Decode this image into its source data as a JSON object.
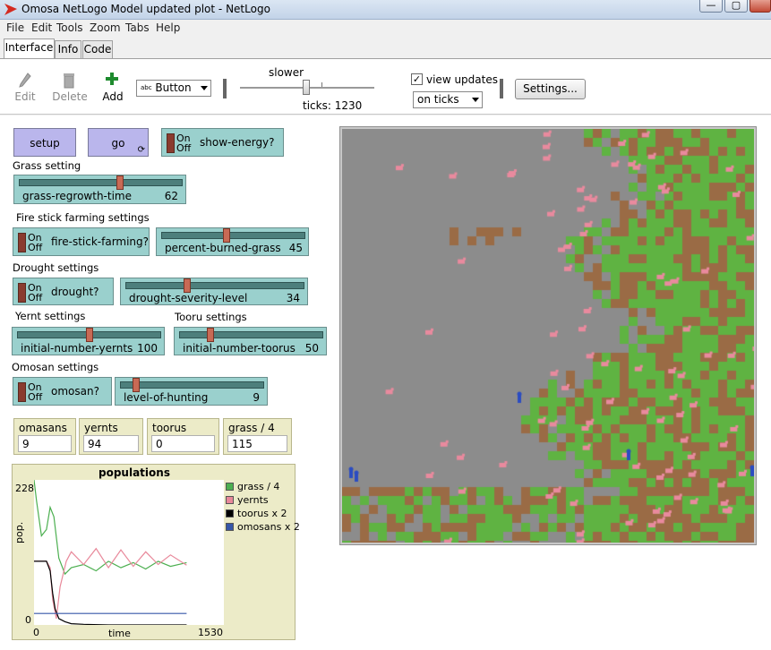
{
  "window": {
    "title": "Omosa NetLogo Model updated plot - NetLogo",
    "minimize": "—",
    "maximize": "▢"
  },
  "menu": [
    "File",
    "Edit",
    "Tools",
    "Zoom",
    "Tabs",
    "Help"
  ],
  "tabs": [
    "Interface",
    "Info",
    "Code"
  ],
  "toolbar": {
    "edit": "Edit",
    "delete": "Delete",
    "add": "Add",
    "widget_select": "Button",
    "widget_select_prefix": "abc",
    "speed_label": "slower",
    "ticks": "ticks: 1230",
    "view_updates": "view updates",
    "update_mode": "on ticks",
    "settings": "Settings..."
  },
  "buttons": {
    "setup": "setup",
    "go": "go"
  },
  "switch_labels": {
    "on": "On",
    "off": "Off"
  },
  "switches": {
    "show_energy": "show-energy?",
    "fire_stick": "fire-stick-farming?",
    "drought": "drought?",
    "omosan": "omosan?"
  },
  "notes": {
    "grass": "Grass setting",
    "fire": "Fire stick farming settings",
    "drought": "Drought settings",
    "yernt": "Yernt settings",
    "tooru": "Tooru settings",
    "omosan": "Omosan settings"
  },
  "sliders": {
    "grass_regrowth": {
      "name": "grass-regrowth-time",
      "value": "62",
      "fraction": 0.62
    },
    "percent_burned": {
      "name": "percent-burned-grass",
      "value": "45",
      "fraction": 0.45
    },
    "drought_severity": {
      "name": "drought-severity-level",
      "value": "34",
      "fraction": 0.34
    },
    "initial_yernts": {
      "name": "initial-number-yernts",
      "value": "100",
      "fraction": 0.5
    },
    "initial_toorus": {
      "name": "initial-number-toorus",
      "value": "50",
      "fraction": 0.2
    },
    "level_hunting": {
      "name": "level-of-hunting",
      "value": "9",
      "fraction": 0.09
    }
  },
  "monitors": [
    {
      "label": "omasans",
      "value": "9"
    },
    {
      "label": "yernts",
      "value": "94"
    },
    {
      "label": "toorus",
      "value": "0"
    },
    {
      "label": "grass / 4",
      "value": "115"
    }
  ],
  "plot": {
    "title": "populations",
    "ymax_label": "228",
    "ymin_label": "0",
    "xmin_label": "0",
    "xmax_label": "1530",
    "xlabel": "time",
    "ylabel": "pop.",
    "legend": [
      {
        "name": "grass / 4",
        "color": "#4caf50"
      },
      {
        "name": "yernts",
        "color": "#e8889a"
      },
      {
        "name": "toorus x 2",
        "color": "#000000"
      },
      {
        "name": "omosans x 2",
        "color": "#3656a8"
      }
    ]
  },
  "chart_data": {
    "type": "line",
    "title": "populations",
    "xlabel": "time",
    "ylabel": "pop.",
    "xlim": [
      0,
      1530
    ],
    "ylim": [
      0,
      228
    ],
    "series": [
      {
        "name": "grass / 4",
        "color": "#4caf50",
        "x": [
          0,
          20,
          60,
          100,
          130,
          160,
          200,
          250,
          300,
          400,
          500,
          600,
          700,
          800,
          900,
          1000,
          1100,
          1230
        ],
        "y": [
          228,
          195,
          140,
          150,
          185,
          170,
          105,
          80,
          90,
          95,
          85,
          100,
          90,
          98,
          88,
          100,
          92,
          98
        ]
      },
      {
        "name": "yernts",
        "color": "#e8889a",
        "x": [
          0,
          50,
          100,
          130,
          150,
          180,
          210,
          260,
          300,
          400,
          500,
          600,
          700,
          800,
          900,
          1000,
          1100,
          1230
        ],
        "y": [
          100,
          100,
          100,
          90,
          40,
          10,
          60,
          100,
          115,
          95,
          120,
          90,
          118,
          92,
          115,
          95,
          110,
          94
        ]
      },
      {
        "name": "toorus x 2",
        "color": "#000000",
        "x": [
          0,
          100,
          130,
          150,
          170,
          200,
          250,
          300,
          400,
          600,
          800,
          1000,
          1230
        ],
        "y": [
          100,
          100,
          85,
          50,
          25,
          10,
          5,
          2,
          1,
          0,
          0,
          0,
          0
        ]
      },
      {
        "name": "omosans x 2",
        "color": "#3656a8",
        "x": [
          0,
          200,
          400,
          600,
          800,
          1000,
          1230
        ],
        "y": [
          18,
          18,
          18,
          18,
          18,
          18,
          18
        ]
      }
    ]
  }
}
